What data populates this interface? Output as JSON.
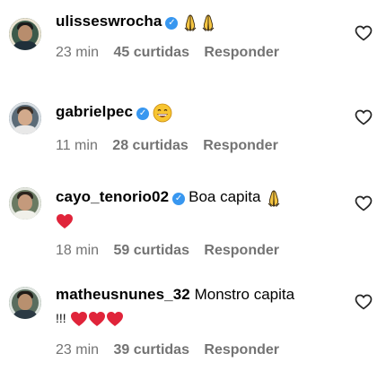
{
  "comments": [
    {
      "username": "ulisseswrocha",
      "verified": true,
      "text": "",
      "emojis": [
        "praying-hands",
        "praying-hands"
      ],
      "time": "23 min",
      "likes": "45 curtidas",
      "reply": "Responder",
      "avatar_colors": {
        "bg": "#3d5a4a",
        "ring": "#e9e2d0"
      }
    },
    {
      "username": "gabrielpec",
      "verified": true,
      "text": "",
      "emojis": [
        "grinning-face"
      ],
      "time": "11 min",
      "likes": "28 curtidas",
      "reply": "Responder",
      "avatar_colors": {
        "bg": "#5b6b77",
        "ring": "#d7dde2"
      }
    },
    {
      "username": "cayo_tenorio02",
      "verified": true,
      "text": "Boa capita",
      "emojis": [
        "praying-hands",
        "red-heart"
      ],
      "time": "18 min",
      "likes": "59 curtidas",
      "reply": "Responder",
      "avatar_colors": {
        "bg": "#6a7a62",
        "ring": "#e3e6df"
      }
    },
    {
      "username": "matheusnunes_32",
      "verified": false,
      "text": "Monstro capita",
      "text2": "!!!",
      "emojis": [
        "red-heart",
        "red-heart",
        "red-heart"
      ],
      "time": "23 min",
      "likes": "39 curtidas",
      "reply": "Responder",
      "avatar_colors": {
        "bg": "#5a6d5e",
        "ring": "#dfe5e0"
      }
    }
  ],
  "colors": {
    "verified": "#3897f0",
    "meta_text": "#737373",
    "heart_red": "#e0243a"
  }
}
